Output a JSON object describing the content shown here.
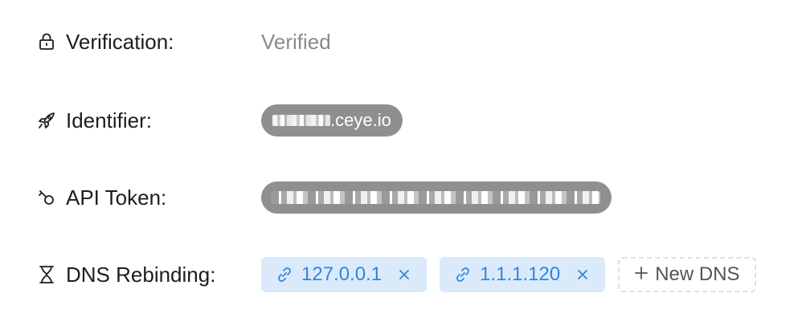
{
  "fields": {
    "verification": {
      "label": "Verification:",
      "icon": "lock-icon",
      "value": "Verified"
    },
    "identifier": {
      "label": "Identifier:",
      "icon": "rocket-icon",
      "value_suffix": ".ceye.io"
    },
    "api_token": {
      "label": "API Token:",
      "icon": "key-icon"
    },
    "dns_rebinding": {
      "label": "DNS Rebinding:",
      "icon": "hourglass-icon",
      "tags": [
        {
          "value": "127.0.0.1"
        },
        {
          "value": "1.1.1.120"
        }
      ],
      "add_label": "New DNS"
    }
  },
  "colors": {
    "tag_background": "#dbeafb",
    "tag_text": "#2f86de",
    "pill_background": "#8f8f8f",
    "muted_text": "#8a8a8a"
  }
}
